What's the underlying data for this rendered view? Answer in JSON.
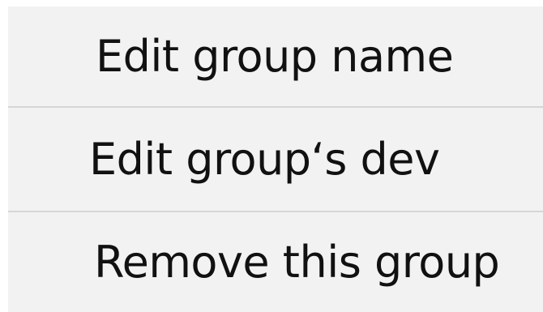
{
  "context_menu": {
    "items": [
      {
        "label": "Edit group name"
      },
      {
        "label": "Edit group‘s dev"
      },
      {
        "label": "Remove this group"
      }
    ]
  }
}
